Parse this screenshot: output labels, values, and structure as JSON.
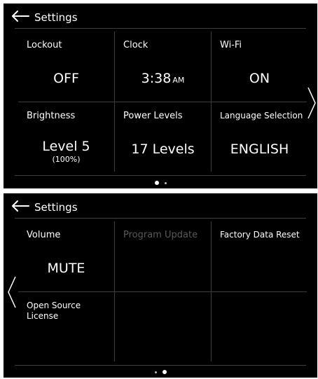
{
  "page1": {
    "title": "Settings",
    "cells": [
      {
        "label": "Lockout",
        "value": "OFF"
      },
      {
        "label": "Clock",
        "value": "3:38",
        "suffix": "AM"
      },
      {
        "label": "Wi-Fi",
        "value": "ON"
      },
      {
        "label": "Brightness",
        "value": "Level 5",
        "sub": "(100%)"
      },
      {
        "label": "Power Levels",
        "value": "17 Levels"
      },
      {
        "label": "Language Selection",
        "value": "ENGLISH"
      }
    ],
    "page_indicator": {
      "current": 1,
      "total": 2
    }
  },
  "page2": {
    "title": "Settings",
    "cells": [
      {
        "label": "Volume",
        "value": "MUTE"
      },
      {
        "label": "Program Update",
        "disabled": true
      },
      {
        "label": "Factory Data Reset"
      },
      {
        "label": "Open Source\nLicense"
      }
    ],
    "page_indicator": {
      "current": 2,
      "total": 2
    }
  },
  "icons": {
    "back": "arrow-left-icon",
    "next": "chevron-right-icon",
    "prev": "chevron-left-icon"
  },
  "colors": {
    "screen_bg": "#000000",
    "text": "#ffffff",
    "disabled_text": "#5a5a5a",
    "divider": "#3e3e3e"
  }
}
